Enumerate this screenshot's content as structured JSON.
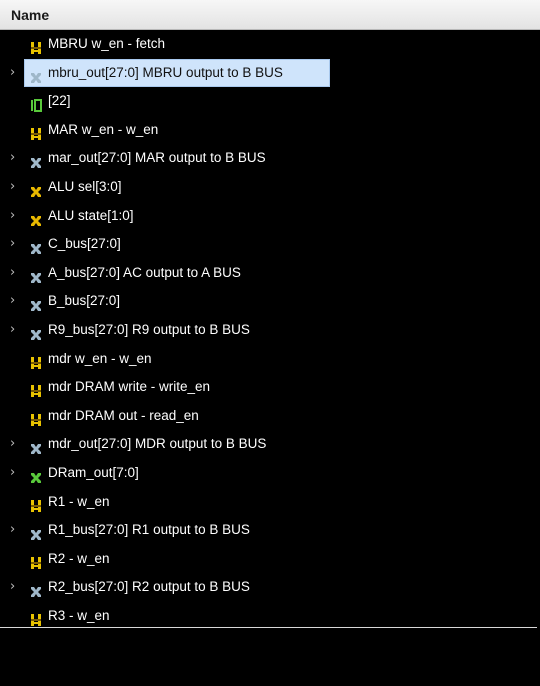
{
  "header": {
    "name_label": "Name"
  },
  "signals": [
    {
      "label": "MBRU w_en - fetch",
      "expandable": false,
      "selected": false,
      "icon": "wire-icon",
      "icon_color": "#e8c200"
    },
    {
      "label": "mbru_out[27:0]  MBRU output to B BUS",
      "expandable": true,
      "selected": true,
      "icon": "bus-icon",
      "icon_color": "#9fb7c9"
    },
    {
      "label": "[22]",
      "expandable": false,
      "selected": false,
      "icon": "bit-icon",
      "icon_color": "#59c93b"
    },
    {
      "label": "MAR w_en - w_en",
      "expandable": false,
      "selected": false,
      "icon": "wire-icon",
      "icon_color": "#e8c200"
    },
    {
      "label": "mar_out[27:0]  MAR output to B BUS",
      "expandable": true,
      "selected": false,
      "icon": "bus-icon",
      "icon_color": "#9fb7c9"
    },
    {
      "label": "ALU sel[3:0]",
      "expandable": true,
      "selected": false,
      "icon": "bus-icon",
      "icon_color": "#e8b800"
    },
    {
      "label": "ALU state[1:0]",
      "expandable": true,
      "selected": false,
      "icon": "bus-icon",
      "icon_color": "#e8b800"
    },
    {
      "label": "C_bus[27:0]",
      "expandable": true,
      "selected": false,
      "icon": "bus-icon",
      "icon_color": "#9fb7c9"
    },
    {
      "label": "A_bus[27:0]  AC output to A BUS",
      "expandable": true,
      "selected": false,
      "icon": "bus-icon",
      "icon_color": "#9fb7c9"
    },
    {
      "label": "B_bus[27:0]",
      "expandable": true,
      "selected": false,
      "icon": "bus-icon",
      "icon_color": "#9fb7c9"
    },
    {
      "label": "R9_bus[27:0]  R9 output to B BUS",
      "expandable": true,
      "selected": false,
      "icon": "bus-icon",
      "icon_color": "#9fb7c9"
    },
    {
      "label": "mdr w_en - w_en",
      "expandable": false,
      "selected": false,
      "icon": "wire-icon",
      "icon_color": "#e8c200"
    },
    {
      "label": "mdr DRAM write - write_en",
      "expandable": false,
      "selected": false,
      "icon": "wire-icon",
      "icon_color": "#e8c200"
    },
    {
      "label": "mdr DRAM out - read_en",
      "expandable": false,
      "selected": false,
      "icon": "wire-icon",
      "icon_color": "#e8c200"
    },
    {
      "label": "mdr_out[27:0]  MDR output to B BUS",
      "expandable": true,
      "selected": false,
      "icon": "bus-icon",
      "icon_color": "#9fb7c9"
    },
    {
      "label": "DRam_out[7:0]",
      "expandable": true,
      "selected": false,
      "icon": "bus-icon",
      "icon_color": "#59c93b"
    },
    {
      "label": "R1 - w_en",
      "expandable": false,
      "selected": false,
      "icon": "wire-icon",
      "icon_color": "#e8c200"
    },
    {
      "label": "R1_bus[27:0] R1 output to B BUS",
      "expandable": true,
      "selected": false,
      "icon": "bus-icon",
      "icon_color": "#9fb7c9"
    },
    {
      "label": "R2 - w_en",
      "expandable": false,
      "selected": false,
      "icon": "wire-icon",
      "icon_color": "#e8c200"
    },
    {
      "label": "R2_bus[27:0]  R2 output to B BUS",
      "expandable": true,
      "selected": false,
      "icon": "bus-icon",
      "icon_color": "#9fb7c9"
    },
    {
      "label": "R3 - w_en",
      "expandable": false,
      "selected": false,
      "icon": "wire-icon",
      "icon_color": "#e8c200"
    }
  ],
  "colors": {
    "background": "#000000",
    "selection": "#cfe4fb",
    "text": "#ffffff",
    "chevron": "#bfbfbf"
  }
}
